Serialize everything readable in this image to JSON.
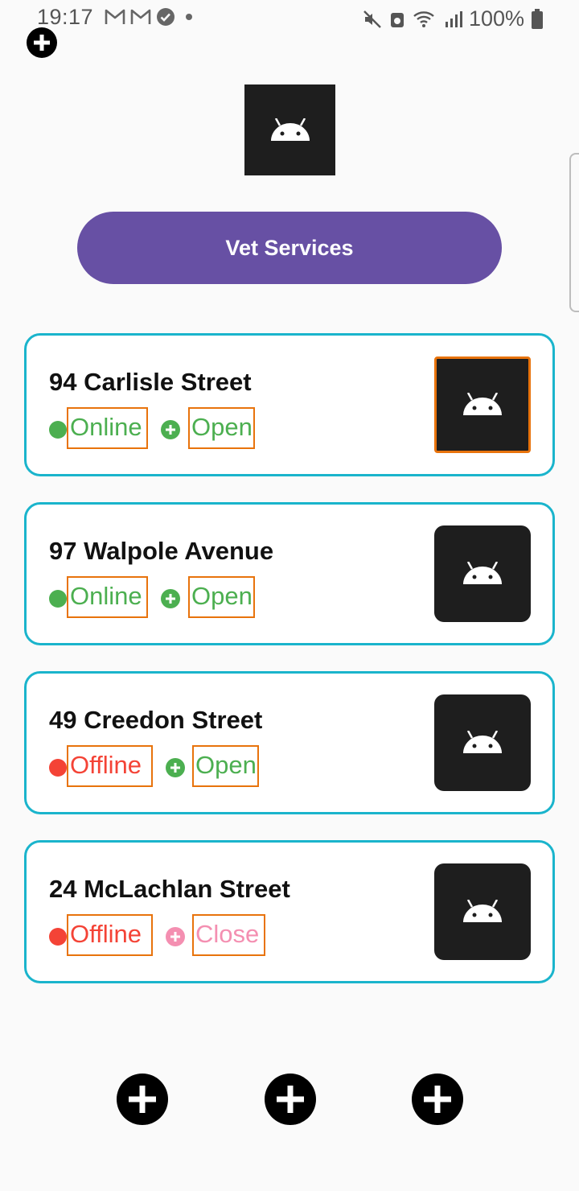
{
  "status_bar": {
    "time": "19:17",
    "battery": "100%",
    "icons_left": [
      "gmail-icon",
      "gmail-icon",
      "check-circle-icon",
      "dot-icon"
    ],
    "icons_right": [
      "mute-icon",
      "recycle-icon",
      "wifi-icon",
      "signal-icon",
      "battery-icon"
    ]
  },
  "header": {
    "logo_icon": "android-icon",
    "button_label": "Vet Services"
  },
  "colors": {
    "accent": "#6750a4",
    "card_border": "#1ab4cc",
    "highlight": "#e8730c",
    "online": "#4caf50",
    "offline": "#f44336",
    "closed": "#f48fb1"
  },
  "locations": [
    {
      "name": "94 Carlisle Street",
      "connection": "Online",
      "hours": "Open"
    },
    {
      "name": "97 Walpole Avenue",
      "connection": "Online",
      "hours": "Open"
    },
    {
      "name": "49 Creedon Street",
      "connection": "Offline",
      "hours": "Open"
    },
    {
      "name": "24 McLachlan Street",
      "connection": "Offline",
      "hours": "Close"
    }
  ],
  "bottom_actions": [
    "add-icon",
    "add-icon",
    "add-icon"
  ]
}
